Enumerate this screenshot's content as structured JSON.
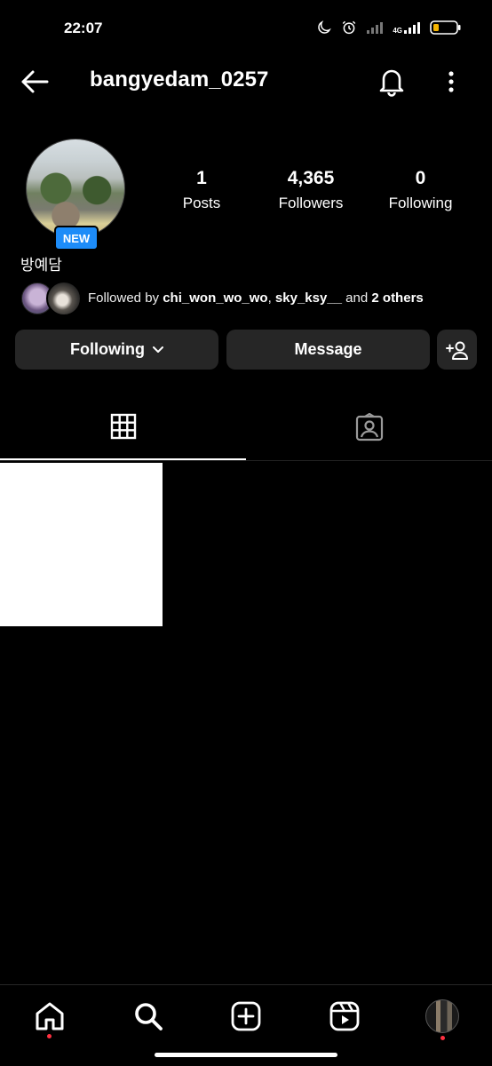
{
  "status_bar": {
    "time": "22:07",
    "network": "4G",
    "icons": [
      "moon-icon",
      "alarm-icon",
      "signal-icon",
      "signal-icon",
      "battery-icon"
    ]
  },
  "header": {
    "username": "bangyedam_0257",
    "icons": [
      "back-arrow-icon",
      "bell-icon",
      "more-vertical-icon"
    ]
  },
  "profile": {
    "badge": "NEW",
    "display_name": "방예담",
    "stats": [
      {
        "value": "1",
        "label": "Posts"
      },
      {
        "value": "4,365",
        "label": "Followers"
      },
      {
        "value": "0",
        "label": "Following"
      }
    ],
    "followed_by": {
      "prefix": "Followed by ",
      "user1": "chi_won_wo_wo",
      "sep": ", ",
      "user2": "sky_ksy__",
      "mid": " and ",
      "others": "2 others"
    }
  },
  "actions": {
    "following_label": "Following",
    "message_label": "Message",
    "add_user_icon": "add-user-icon"
  },
  "tabs": [
    {
      "name": "grid",
      "icon": "grid-icon",
      "active": true
    },
    {
      "name": "tagged",
      "icon": "tagged-icon",
      "active": false
    }
  ],
  "bottom_nav": [
    "home-icon",
    "search-icon",
    "create-icon",
    "reels-icon",
    "profile-avatar"
  ],
  "colors": {
    "background": "#000000",
    "button_bg": "#262626",
    "badge_blue": "#1d8cf8",
    "notification_red": "#ff3040"
  }
}
